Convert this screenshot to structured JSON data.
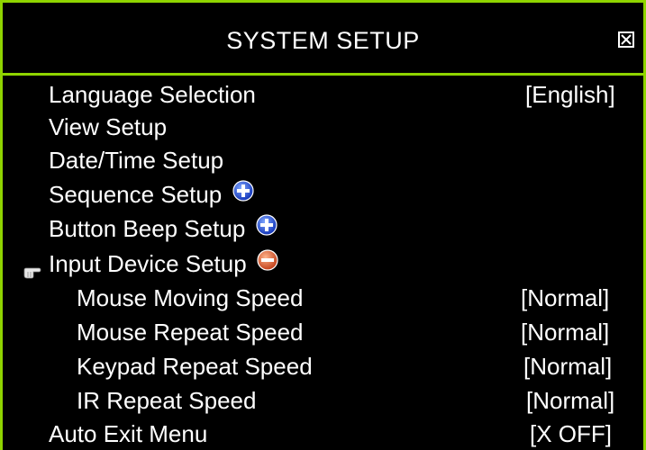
{
  "window": {
    "title": "SYSTEM SETUP",
    "close_icon": "close-box-icon"
  },
  "menu": [
    {
      "label": "Language Selection",
      "value": "[English]"
    },
    {
      "label": "View Setup",
      "value": ""
    },
    {
      "label": "Date/Time Setup",
      "value": ""
    },
    {
      "label": "Sequence Setup",
      "value": "",
      "icon": "plus-circle-icon"
    },
    {
      "label": "Button Beep Setup",
      "value": "",
      "icon": "plus-circle-icon"
    },
    {
      "label": "Input Device Setup",
      "value": "",
      "icon": "minus-circle-icon",
      "pointer": "hand-pointer-icon",
      "selected": true
    },
    {
      "label": "Mouse Moving Speed",
      "value": "[Normal]"
    },
    {
      "label": "Mouse Repeat Speed",
      "value": "[Normal]"
    },
    {
      "label": "Keypad Repeat Speed",
      "value": "[Normal]"
    },
    {
      "label": "IR Repeat Speed",
      "value": "[Normal]"
    },
    {
      "label": "Auto Exit Menu",
      "value": "[X OFF]"
    }
  ],
  "colors": {
    "frame": "#8fd400",
    "background": "#000000",
    "text": "#ffffff",
    "plus_icon": "#1f4fd8",
    "minus_icon": "#d9552a"
  }
}
